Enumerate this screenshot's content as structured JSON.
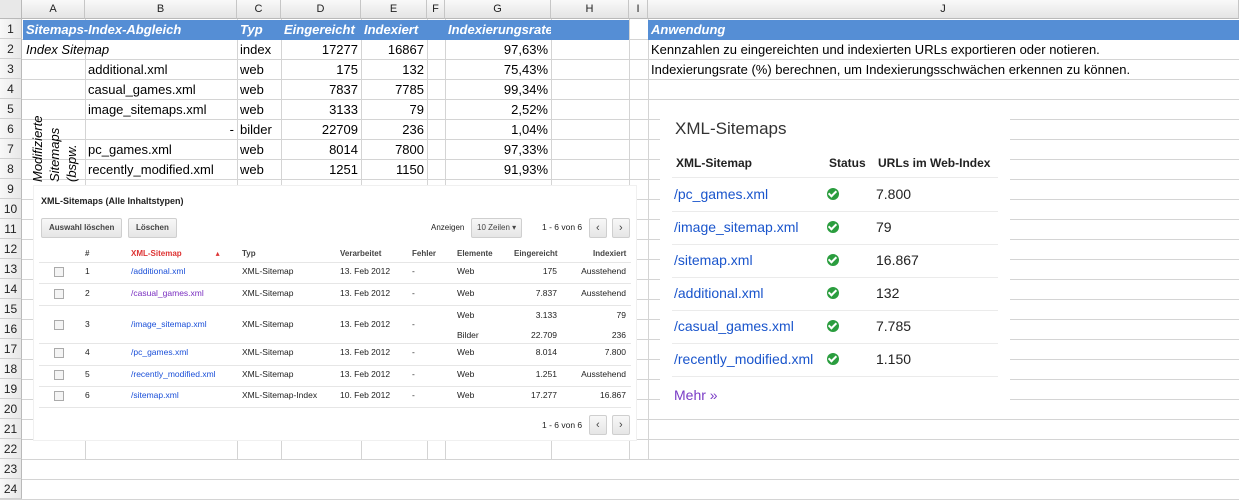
{
  "columns": [
    "A",
    "B",
    "C",
    "D",
    "E",
    "F",
    "G",
    "H",
    "I",
    "J"
  ],
  "rows": [
    "1",
    "2",
    "3",
    "4",
    "5",
    "6",
    "7",
    "8",
    "9",
    "10",
    "11",
    "12",
    "13",
    "14",
    "15",
    "16",
    "17",
    "18",
    "19",
    "20",
    "21",
    "22",
    "23",
    "24"
  ],
  "table": {
    "header": {
      "title": "Sitemaps-Index-Abgleich",
      "typ": "Typ",
      "eingereicht": "Eingereicht",
      "indexiert": "Indexiert",
      "rate": "Indexierungsrate"
    },
    "index_row": {
      "name": "Index Sitemap",
      "typ": "index",
      "eingereicht": "17277",
      "indexiert": "16867",
      "rate": "97,63%"
    },
    "sub_rows": [
      {
        "name": "additional.xml",
        "typ": "web",
        "eingereicht": "175",
        "indexiert": "132",
        "rate": "75,43%"
      },
      {
        "name": "casual_games.xml",
        "typ": "web",
        "eingereicht": "7837",
        "indexiert": "7785",
        "rate": "99,34%"
      },
      {
        "name": "image_sitemaps.xml",
        "typ": "web",
        "eingereicht": "3133",
        "indexiert": "79",
        "rate": "2,52%"
      },
      {
        "name": "-",
        "typ": "bilder",
        "eingereicht": "22709",
        "indexiert": "236",
        "rate": "1,04%"
      },
      {
        "name": "pc_games.xml",
        "typ": "web",
        "eingereicht": "8014",
        "indexiert": "7800",
        "rate": "97,33%"
      },
      {
        "name": "recently_modified.xml",
        "typ": "web",
        "eingereicht": "1251",
        "indexiert": "1150",
        "rate": "91,93%"
      }
    ],
    "vertical_label": {
      "line1": "Modifizierte",
      "line2": "Sitemaps",
      "line3": "(bspw."
    }
  },
  "anwendung": {
    "header": "Anwendung",
    "line1": "Kennzahlen zu eingereichten und indexierten URLs exportieren oder notieren.",
    "line2": "Indexierungsrate (%) berechnen, um Indexierungsschwächen erkennen zu können."
  },
  "shot1": {
    "title": "XML-Sitemaps (Alle Inhaltstypen)",
    "btn_clear": "Auswahl löschen",
    "btn_delete": "Löschen",
    "show_label": "Anzeigen",
    "rows_select": "10 Zeilen",
    "pager": "1 - 6 von 6",
    "pager_bottom": "1 - 6 von 6",
    "headers": {
      "num": "#",
      "sitemap": "XML-Sitemap",
      "typ": "Typ",
      "verarbeitet": "Verarbeitet",
      "fehler": "Fehler",
      "elemente": "Elemente",
      "eingereicht": "Eingereicht",
      "indexiert": "Indexiert"
    },
    "rows": [
      {
        "num": "1",
        "sitemap": "/additional.xml",
        "typ": "XML-Sitemap",
        "date": "13. Feb 2012",
        "fehler": "-",
        "el": "Web",
        "ein": "175",
        "idx": "Ausstehend"
      },
      {
        "num": "2",
        "sitemap": "/casual_games.xml",
        "typ": "XML-Sitemap",
        "date": "13. Feb 2012",
        "fehler": "-",
        "el": "Web",
        "ein": "7.837",
        "idx": "Ausstehend"
      },
      {
        "num": "3",
        "sitemap": "/image_sitemap.xml",
        "typ": "XML-Sitemap",
        "date": "13. Feb 2012",
        "fehler": "-",
        "el": "Web",
        "ein": "3.133",
        "idx": "79",
        "el2": "Bilder",
        "ein2": "22.709",
        "idx2": "236"
      },
      {
        "num": "4",
        "sitemap": "/pc_games.xml",
        "typ": "XML-Sitemap",
        "date": "13. Feb 2012",
        "fehler": "-",
        "el": "Web",
        "ein": "8.014",
        "idx": "7.800"
      },
      {
        "num": "5",
        "sitemap": "/recently_modified.xml",
        "typ": "XML-Sitemap",
        "date": "13. Feb 2012",
        "fehler": "-",
        "el": "Web",
        "ein": "1.251",
        "idx": "Ausstehend"
      },
      {
        "num": "6",
        "sitemap": "/sitemap.xml",
        "typ": "XML-Sitemap-Index",
        "date": "10. Feb 2012",
        "fehler": "-",
        "el": "Web",
        "ein": "17.277",
        "idx": "16.867"
      }
    ]
  },
  "shot2": {
    "title": "XML-Sitemaps",
    "headers": {
      "sitemap": "XML-Sitemap",
      "status": "Status",
      "urls": "URLs im Web-Index"
    },
    "rows": [
      {
        "link": "/pc_games.xml",
        "val": "7.800"
      },
      {
        "link": "/image_sitemap.xml",
        "val": "79"
      },
      {
        "link": "/sitemap.xml",
        "val": "16.867"
      },
      {
        "link": "/additional.xml",
        "val": "132"
      },
      {
        "link": "/casual_games.xml",
        "val": "7.785"
      },
      {
        "link": "/recently_modified.xml",
        "val": "1.150"
      }
    ],
    "more": "Mehr »"
  },
  "colors": {
    "header_bg": "#558ed5",
    "link": "#1a55cc",
    "visited": "#7a3cc6",
    "check": "#2a9d3e"
  }
}
